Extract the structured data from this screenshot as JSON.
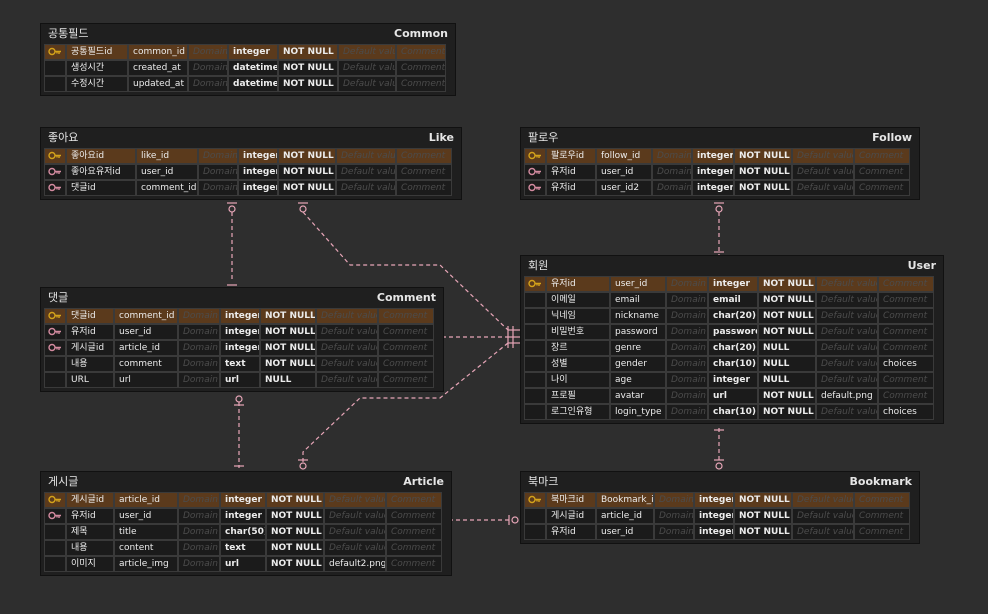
{
  "colors": {
    "background": "#2e2e2e",
    "table_bg": "#1f1f1f",
    "pk_row": "#5b3a1c",
    "pk_icon": "#d4a21a",
    "fk_icon": "#d48ba0",
    "connector": "#e8a6b8",
    "placeholder_text": "#4c4c4c"
  },
  "entities": [
    {
      "id": "common",
      "kr": "공통필드",
      "en": "Common",
      "rows": [
        {
          "key": "pk",
          "logical": "공통필드id",
          "physical": "common_id",
          "domain": "Domain",
          "type": "integer",
          "null": "NOT NULL",
          "default": "Default value",
          "comment": "Comment"
        },
        {
          "key": "",
          "logical": "생성시간",
          "physical": "created_at",
          "domain": "Domain",
          "type": "datetime",
          "null": "NOT NULL",
          "default": "Default value",
          "comment": "Comment"
        },
        {
          "key": "",
          "logical": "수정시간",
          "physical": "updated_at",
          "domain": "Domain",
          "type": "datetime",
          "null": "NOT NULL",
          "default": "Default value",
          "comment": "Comment"
        }
      ]
    },
    {
      "id": "like",
      "kr": "좋아요",
      "en": "Like",
      "rows": [
        {
          "key": "pk",
          "logical": "좋아요id",
          "physical": "like_id",
          "domain": "Domain",
          "type": "integer",
          "null": "NOT NULL",
          "default": "Default value",
          "comment": "Comment"
        },
        {
          "key": "fk",
          "logical": "좋아요유저id",
          "physical": "user_id",
          "domain": "Domain",
          "type": "integer",
          "null": "NOT NULL",
          "default": "Default value",
          "comment": "Comment"
        },
        {
          "key": "fk",
          "logical": "댓글id",
          "physical": "comment_id",
          "domain": "Domain",
          "type": "integer",
          "null": "NOT NULL",
          "default": "Default value",
          "comment": "Comment"
        }
      ]
    },
    {
      "id": "follow",
      "kr": "팔로우",
      "en": "Follow",
      "rows": [
        {
          "key": "pk",
          "logical": "팔로우id",
          "physical": "follow_id",
          "domain": "Domain",
          "type": "integer",
          "null": "NOT NULL",
          "default": "Default value",
          "comment": "Comment"
        },
        {
          "key": "fk",
          "logical": "유저id",
          "physical": "user_id",
          "domain": "Domain",
          "type": "integer",
          "null": "NOT NULL",
          "default": "Default value",
          "comment": "Comment"
        },
        {
          "key": "fk",
          "logical": "유저id",
          "physical": "user_id2",
          "domain": "Domain",
          "type": "integer",
          "null": "NOT NULL",
          "default": "Default value",
          "comment": "Comment"
        }
      ]
    },
    {
      "id": "comment",
      "kr": "댓글",
      "en": "Comment",
      "rows": [
        {
          "key": "pk",
          "logical": "댓글id",
          "physical": "comment_id",
          "domain": "Domain",
          "type": "integer",
          "null": "NOT NULL",
          "default": "Default value",
          "comment": "Comment"
        },
        {
          "key": "fk",
          "logical": "유저id",
          "physical": "user_id",
          "domain": "Domain",
          "type": "integer",
          "null": "NOT NULL",
          "default": "Default value",
          "comment": "Comment"
        },
        {
          "key": "fk",
          "logical": "게시글id",
          "physical": "article_id",
          "domain": "Domain",
          "type": "integer",
          "null": "NOT NULL",
          "default": "Default value",
          "comment": "Comment"
        },
        {
          "key": "",
          "logical": "내용",
          "physical": "comment",
          "domain": "Domain",
          "type": "text",
          "null": "NOT NULL",
          "default": "Default value",
          "comment": "Comment"
        },
        {
          "key": "",
          "logical": "URL",
          "physical": "url",
          "domain": "Domain",
          "type": "url",
          "null": "NULL",
          "default": "Default value",
          "comment": "Comment"
        }
      ]
    },
    {
      "id": "user",
      "kr": "회원",
      "en": "User",
      "rows": [
        {
          "key": "pk",
          "logical": "유저id",
          "physical": "user_id",
          "domain": "Domain",
          "type": "integer",
          "null": "NOT NULL",
          "default": "Default value",
          "comment": "Comment"
        },
        {
          "key": "",
          "logical": "이메일",
          "physical": "email",
          "domain": "Domain",
          "type": "email",
          "null": "NOT NULL",
          "default": "Default value",
          "comment": "Comment"
        },
        {
          "key": "",
          "logical": "닉네임",
          "physical": "nickname",
          "domain": "Domain",
          "type": "char(20)",
          "null": "NOT NULL",
          "default": "Default value",
          "comment": "Comment"
        },
        {
          "key": "",
          "logical": "비밀번호",
          "physical": "password",
          "domain": "Domain",
          "type": "password",
          "null": "NOT NULL",
          "default": "Default value",
          "comment": "Comment"
        },
        {
          "key": "",
          "logical": "장르",
          "physical": "genre",
          "domain": "Domain",
          "type": "char(20)",
          "null": "NULL",
          "default": "Default value",
          "comment": "Comment"
        },
        {
          "key": "",
          "logical": "성별",
          "physical": "gender",
          "domain": "Domain",
          "type": "char(10)",
          "null": "NULL",
          "default": "Default value",
          "comment": "choices"
        },
        {
          "key": "",
          "logical": "나이",
          "physical": "age",
          "domain": "Domain",
          "type": "integer",
          "null": "NULL",
          "default": "Default value",
          "comment": "Comment"
        },
        {
          "key": "",
          "logical": "프로필",
          "physical": "avatar",
          "domain": "Domain",
          "type": "url",
          "null": "NOT NULL",
          "default": "default.png",
          "comment": "Comment"
        },
        {
          "key": "",
          "logical": "로그인유형",
          "physical": "login_type",
          "domain": "Domain",
          "type": "char(10)",
          "null": "NOT NULL",
          "default": "Default value",
          "comment": "choices"
        }
      ]
    },
    {
      "id": "article",
      "kr": "게시글",
      "en": "Article",
      "rows": [
        {
          "key": "pk",
          "logical": "게시글id",
          "physical": "article_id",
          "domain": "Domain",
          "type": "integer",
          "null": "NOT NULL",
          "default": "Default value",
          "comment": "Comment"
        },
        {
          "key": "fk",
          "logical": "유저id",
          "physical": "user_id",
          "domain": "Domain",
          "type": "integer",
          "null": "NOT NULL",
          "default": "Default value",
          "comment": "Comment"
        },
        {
          "key": "",
          "logical": "제목",
          "physical": "title",
          "domain": "Domain",
          "type": "char(50)",
          "null": "NOT NULL",
          "default": "Default value",
          "comment": "Comment"
        },
        {
          "key": "",
          "logical": "내용",
          "physical": "content",
          "domain": "Domain",
          "type": "text",
          "null": "NOT NULL",
          "default": "Default value",
          "comment": "Comment"
        },
        {
          "key": "",
          "logical": "이미지",
          "physical": "article_img",
          "domain": "Domain",
          "type": "url",
          "null": "NOT NULL",
          "default": "default2.png",
          "comment": "Comment"
        }
      ]
    },
    {
      "id": "bookmark",
      "kr": "북마크",
      "en": "Bookmark",
      "rows": [
        {
          "key": "pk",
          "logical": "북마크id",
          "physical": "Bookmark_id",
          "domain": "Domain",
          "type": "integer",
          "null": "NOT NULL",
          "default": "Default value",
          "comment": "Comment"
        },
        {
          "key": "",
          "logical": "게시글id",
          "physical": "article_id",
          "domain": "Domain",
          "type": "integer",
          "null": "NOT NULL",
          "default": "Default value",
          "comment": "Comment"
        },
        {
          "key": "",
          "logical": "유저id",
          "physical": "user_id",
          "domain": "Domain",
          "type": "integer",
          "null": "NOT NULL",
          "default": "Default value",
          "comment": "Comment"
        }
      ]
    }
  ]
}
